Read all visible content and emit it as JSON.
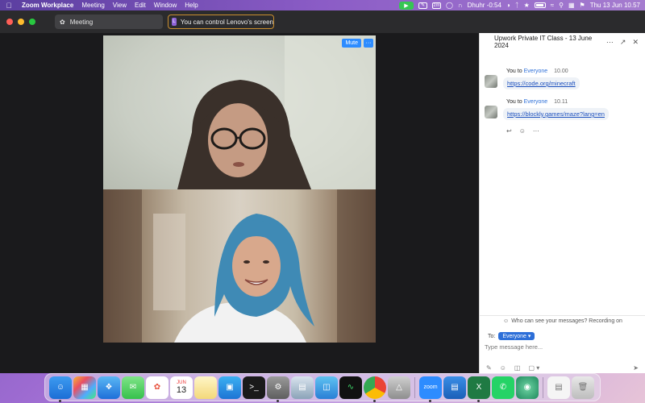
{
  "menubar": {
    "app_name": "Zoom Workplace",
    "menus": [
      "Meeting",
      "View",
      "Edit",
      "Window",
      "Help"
    ],
    "prayer_status": "Dhuhr -0:54",
    "datetime": "Thu 13 Jun  10.57",
    "zoom_badge": "zm"
  },
  "window": {
    "meeting_tab": "Meeting",
    "control_tab": "You can control Lenovo's screen",
    "control_badge": "L"
  },
  "video": {
    "mute_label": "Mute",
    "more_label": "···"
  },
  "chat": {
    "title": "Upwork Private IT Class - 13 June 2024",
    "messages": [
      {
        "from": "You",
        "to_word": "to",
        "to": "Everyone",
        "time": "10.00",
        "text": "https://code.org/minecraft"
      },
      {
        "from": "You",
        "to_word": "to",
        "to": "Everyone",
        "time": "10.11",
        "text": "https://blockly.games/maze?lang=en"
      }
    ],
    "who_can_see": "Who can see your messages? Recording on",
    "to_label": "To:",
    "recipient": "Everyone",
    "input_placeholder": "Type message here..."
  },
  "calendar_icon": {
    "month": "JUN",
    "day": "13"
  },
  "dock_app_label": "zoom",
  "colors": {
    "zoom_blue": "#2d8cff",
    "link_blue": "#1b4fbd",
    "control_border": "#c98e2f"
  }
}
